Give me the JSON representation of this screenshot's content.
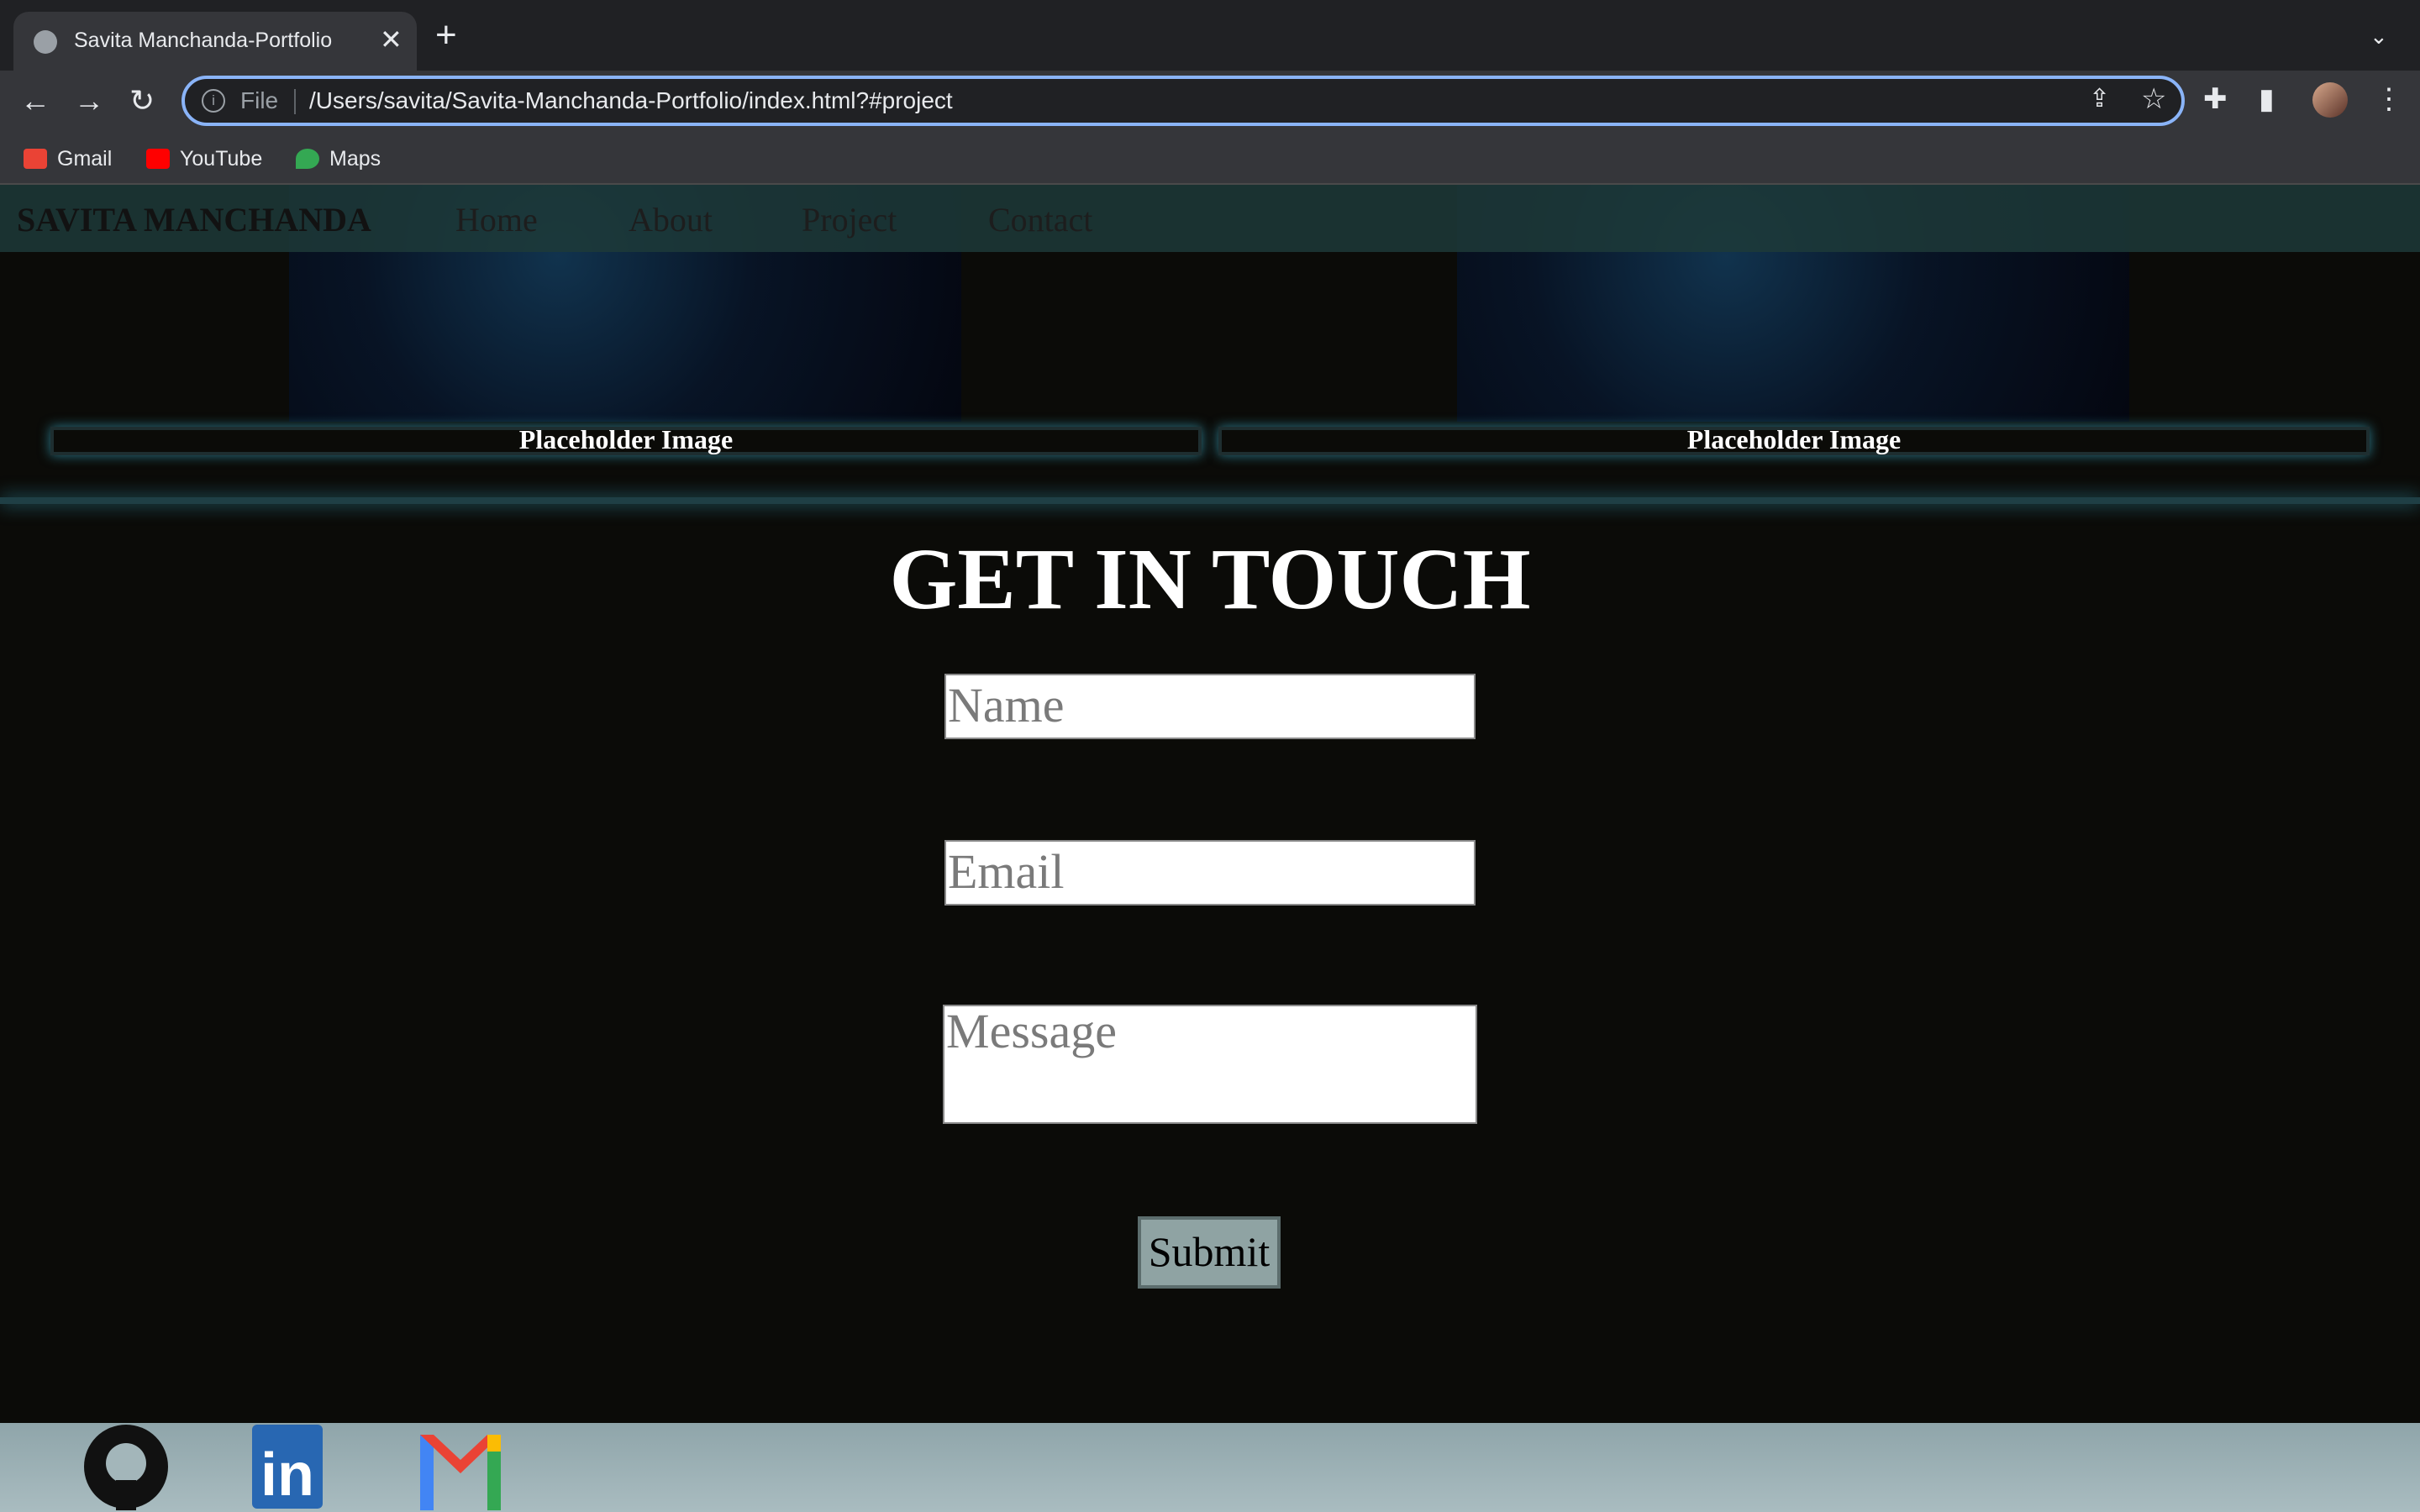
{
  "browser": {
    "tab_title": "Savita Manchanda-Portfolio",
    "url_scheme": "File",
    "url": "/Users/savita/Savita-Manchanda-Portfolio/index.html?#project",
    "bookmarks": [
      {
        "label": "Gmail",
        "icon": "gmail-icon",
        "color": "#ea4335"
      },
      {
        "label": "YouTube",
        "icon": "youtube-icon",
        "color": "#ff0000"
      },
      {
        "label": "Maps",
        "icon": "maps-icon",
        "color": "#34a853"
      }
    ]
  },
  "site": {
    "brand": "SAVITA MANCHANDA",
    "nav": [
      "Home",
      "About",
      "Project",
      "Contact"
    ],
    "projects": [
      {
        "caption": "Placeholder Image"
      },
      {
        "caption": "Placeholder Image"
      }
    ],
    "contact": {
      "title": "GET IN TOUCH",
      "name_placeholder": "Name",
      "email_placeholder": "Email",
      "message_placeholder": "Message",
      "submit_label": "Submit"
    },
    "footer_icons": [
      "github-icon",
      "linkedin-icon",
      "gmail-icon"
    ]
  },
  "colors": {
    "page_bg": "#0b0b08",
    "header_bg": "#1d3a38",
    "glow": "#2f7f92",
    "submit_bg": "#8fa3a3"
  }
}
